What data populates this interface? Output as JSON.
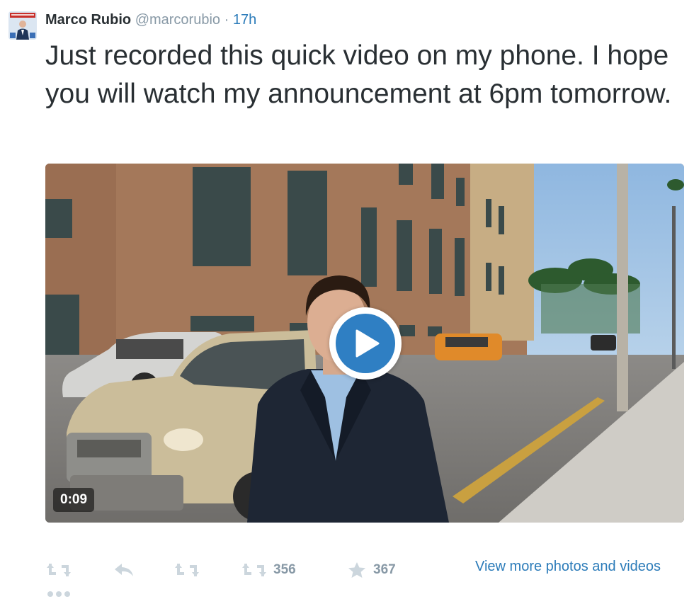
{
  "tweet": {
    "author_name": "Marco Rubio",
    "handle": "@marcorubio",
    "separator": "·",
    "time": "17h",
    "text": "Just recorded this quick video on my phone. I hope you will watch my announcement at 6pm tomorrow."
  },
  "video": {
    "duration": "0:09",
    "play_icon": "play-icon"
  },
  "actions": {
    "retweet_count": "356",
    "favorite_count": "367",
    "view_more_label": "View more photos and videos",
    "icons": [
      "retweet-icon",
      "reply-icon",
      "retweet-icon",
      "retweet-icon",
      "star-icon",
      "more-icon"
    ]
  },
  "colors": {
    "link": "#2b7bb9",
    "muted": "#8899a6",
    "text": "#292f33",
    "play_button": "#2f7fc3"
  }
}
